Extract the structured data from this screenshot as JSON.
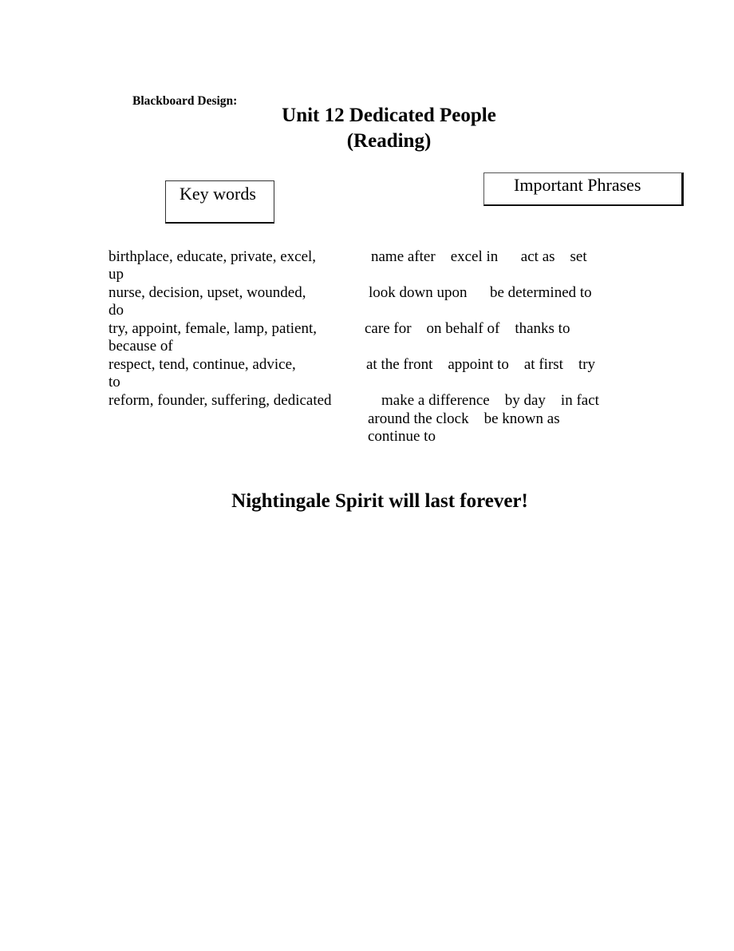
{
  "header": {
    "label": "Blackboard Design:",
    "title_line1": "Unit 12 Dedicated People",
    "title_line2": "(Reading)"
  },
  "boxes": {
    "key_words": "Key words",
    "important_phrases": "Important Phrases"
  },
  "key_words": [
    {
      "text": "birthplace, educate, private, excel,",
      "wrap": "up"
    },
    {
      "text": "nurse, decision, upset, wounded,",
      "wrap": "do"
    },
    {
      "text": "try, appoint, female, lamp, patient,",
      "wrap": "because of"
    },
    {
      "text": "respect, tend, continue, advice,",
      "wrap": "to"
    },
    {
      "text": "reform, founder, suffering, dedicated",
      "wrap": ""
    }
  ],
  "phrases": [
    "name after    excel in      act as    set",
    "look down upon      be determined to",
    "care for    on behalf of    thanks to",
    "at the front    appoint to    at first    try",
    "make a difference    by day    in fact",
    "around the clock    be known as",
    "continue to"
  ],
  "footer": {
    "slogan": "Nightingale Spirit will last forever!"
  }
}
